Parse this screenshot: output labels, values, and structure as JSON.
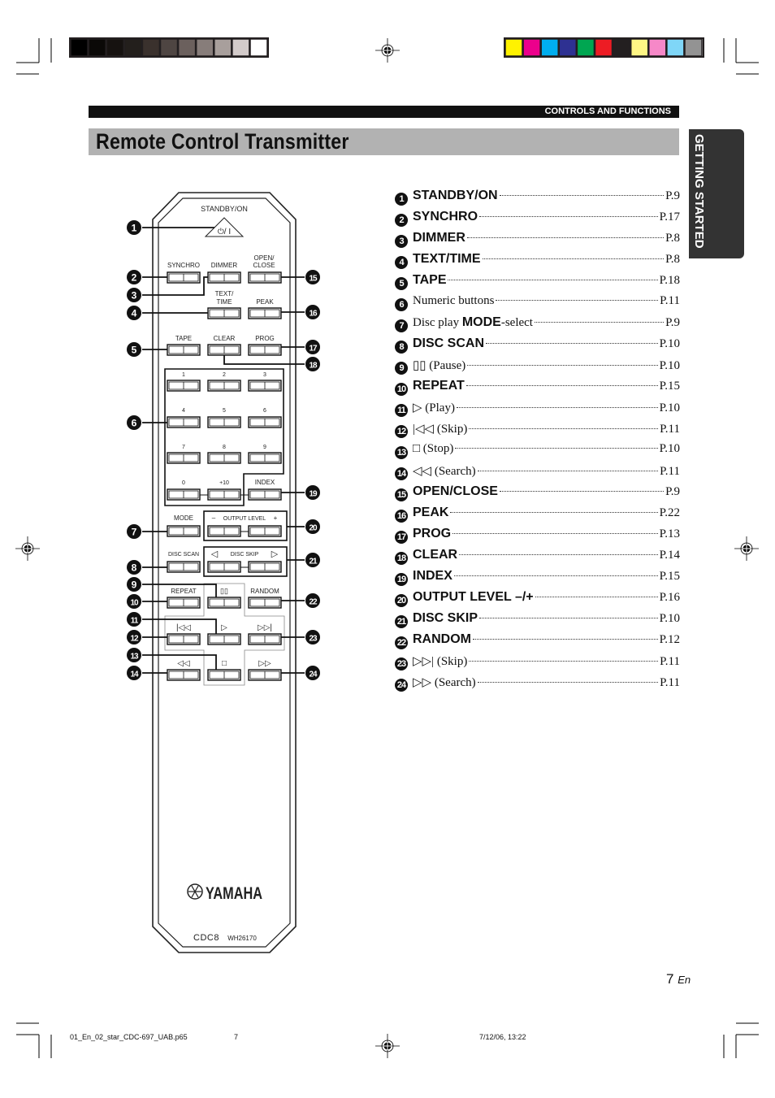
{
  "header": {
    "section": "CONTROLS AND FUNCTIONS",
    "title": "Remote Control Transmitter",
    "side_tab": "GETTING STARTED"
  },
  "color_bars": {
    "grays": [
      "#000000",
      "#0b0907",
      "#161210",
      "#231f1c",
      "#3a312d",
      "#4e4542",
      "#6b605d",
      "#877d7a",
      "#a89f9c",
      "#d3cbca",
      "#ffffff"
    ],
    "colors": [
      "#fff200",
      "#ec008c",
      "#00aeef",
      "#2e3192",
      "#00a651",
      "#ed1c24",
      "#231f20",
      "#fff685",
      "#f688c8",
      "#7fd6f7",
      "#939393"
    ]
  },
  "remote": {
    "standby_label": "STANDBY/ON",
    "standby_symbol": "⏻/ I",
    "labels": [
      "SYNCHRO",
      "DIMMER",
      "OPEN/",
      "CLOSE",
      "TEXT/",
      "TIME",
      "PEAK",
      "TAPE",
      "CLEAR",
      "PROG",
      "1",
      "2",
      "3",
      "4",
      "5",
      "6",
      "7",
      "8",
      "9",
      "0",
      "+10",
      "INDEX",
      "MODE",
      "–",
      "OUTPUT LEVEL",
      "+",
      "DISC SCAN",
      "◁",
      "DISC SKIP",
      "▷",
      "REPEAT",
      "▯▯",
      "RANDOM",
      "|◁◁",
      "▷",
      "▷▷|",
      "◁◁",
      "□",
      "▷▷"
    ],
    "brand": "YAMAHA",
    "model": "CDC8",
    "code": "WH26170"
  },
  "items": [
    {
      "n": "1",
      "parts": [
        {
          "t": "STANDBY/ON",
          "b": true
        }
      ],
      "page": "P.9"
    },
    {
      "n": "2",
      "parts": [
        {
          "t": "SYNCHRO",
          "b": true
        }
      ],
      "page": "P.17"
    },
    {
      "n": "3",
      "parts": [
        {
          "t": "DIMMER",
          "b": true
        }
      ],
      "page": "P.8"
    },
    {
      "n": "4",
      "parts": [
        {
          "t": "TEXT/TIME",
          "b": true
        }
      ],
      "page": "P.8"
    },
    {
      "n": "5",
      "parts": [
        {
          "t": "TAPE",
          "b": true
        }
      ],
      "page": "P.18"
    },
    {
      "n": "6",
      "parts": [
        {
          "t": "Numeric buttons",
          "b": false
        }
      ],
      "page": "P.11"
    },
    {
      "n": "7",
      "parts": [
        {
          "t": "Disc play ",
          "b": false
        },
        {
          "t": "MODE",
          "b": true
        },
        {
          "t": "-select",
          "b": false
        }
      ],
      "page": "P.9"
    },
    {
      "n": "8",
      "parts": [
        {
          "t": "DISC SCAN",
          "b": true
        }
      ],
      "page": "P.10"
    },
    {
      "n": "9",
      "parts": [
        {
          "t": "▯▯ (Pause)",
          "b": false
        }
      ],
      "page": "P.10"
    },
    {
      "n": "10",
      "parts": [
        {
          "t": "REPEAT",
          "b": true
        }
      ],
      "page": "P.15"
    },
    {
      "n": "11",
      "parts": [
        {
          "t": "▷ (Play)",
          "b": false
        }
      ],
      "page": "P.10"
    },
    {
      "n": "12",
      "parts": [
        {
          "t": "|◁◁ (Skip)",
          "b": false
        }
      ],
      "page": "P.11"
    },
    {
      "n": "13",
      "parts": [
        {
          "t": "□ (Stop)",
          "b": false
        }
      ],
      "page": "P.10"
    },
    {
      "n": "14",
      "parts": [
        {
          "t": "◁◁ (Search)",
          "b": false
        }
      ],
      "page": "P.11"
    },
    {
      "n": "15",
      "parts": [
        {
          "t": "OPEN/CLOSE",
          "b": true
        }
      ],
      "page": "P.9"
    },
    {
      "n": "16",
      "parts": [
        {
          "t": "PEAK",
          "b": true
        }
      ],
      "page": "P.22"
    },
    {
      "n": "17",
      "parts": [
        {
          "t": "PROG",
          "b": true
        }
      ],
      "page": "P.13"
    },
    {
      "n": "18",
      "parts": [
        {
          "t": "CLEAR",
          "b": true
        }
      ],
      "page": "P.14"
    },
    {
      "n": "19",
      "parts": [
        {
          "t": "INDEX",
          "b": true
        }
      ],
      "page": "P.15"
    },
    {
      "n": "20",
      "parts": [
        {
          "t": "OUTPUT LEVEL –/+",
          "b": true
        }
      ],
      "page": "P.16"
    },
    {
      "n": "21",
      "parts": [
        {
          "t": "DISC SKIP",
          "b": true
        }
      ],
      "page": "P.10"
    },
    {
      "n": "22",
      "parts": [
        {
          "t": "RANDOM",
          "b": true
        }
      ],
      "page": "P.12"
    },
    {
      "n": "23",
      "parts": [
        {
          "t": "▷▷| (Skip)",
          "b": false
        }
      ],
      "page": "P.11"
    },
    {
      "n": "24",
      "parts": [
        {
          "t": "▷▷ (Search)",
          "b": false
        }
      ],
      "page": "P.11"
    }
  ],
  "page_number": {
    "num": "7",
    "lang": "En"
  },
  "footer": {
    "file": "01_En_02_star_CDC-697_UAB.p65",
    "page": "7",
    "date": "7/12/06, 13:22"
  }
}
